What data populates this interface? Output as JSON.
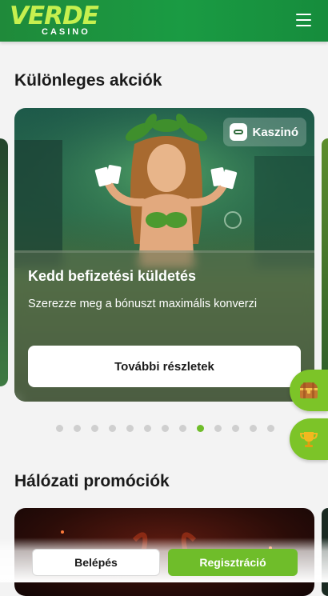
{
  "header": {
    "logo_main": "VERDE",
    "logo_sub": "CASINO",
    "menu_icon": "hamburger-menu-icon"
  },
  "special_offers": {
    "title": "Különleges akciók",
    "card": {
      "badge_label": "Kaszinó",
      "badge_icon": "gamepad-icon",
      "title": "Kedd befizetési küldetés",
      "description": "Szerezze meg a bónuszt maximális konverzi",
      "button_label": "További részletek"
    },
    "carousel": {
      "dot_count": 13,
      "active_index": 8
    }
  },
  "floating_buttons": [
    {
      "icon": "treasure-chest-icon"
    },
    {
      "icon": "trophy-icon"
    }
  ],
  "network_promos": {
    "title": "Hálózati promóciók"
  },
  "bottom_bar": {
    "login_label": "Belépés",
    "register_label": "Regisztráció"
  },
  "colors": {
    "brand_green": "#1a9b43",
    "accent_lime": "#6fbd2a",
    "logo_lime": "#c6f04f"
  }
}
